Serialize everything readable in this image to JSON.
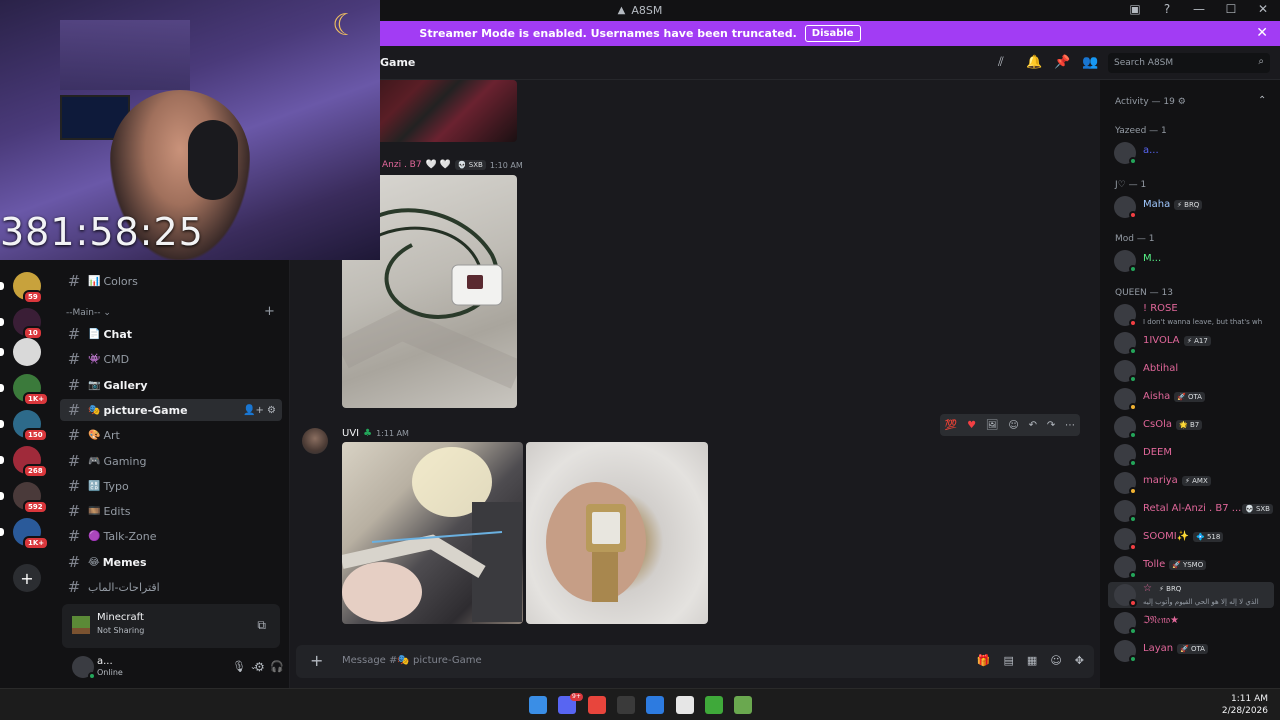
{
  "window": {
    "title": "A8SM",
    "controls": {
      "help": "?",
      "minimize": "—",
      "maximize": "☐",
      "close": "✕"
    }
  },
  "banner": {
    "text": "Streamer Mode is enabled. Usernames have been truncated.",
    "disable_label": "Disable"
  },
  "overlay": {
    "timer": "381:58:25"
  },
  "rail": {
    "servers": [
      {
        "badge": "59",
        "color": "#c8a23c"
      },
      {
        "badge": "10",
        "color": "#3a1e36"
      },
      {
        "badge": "",
        "color": "#d9d9d9"
      },
      {
        "badge": "1K+",
        "color": "#3b7a3b"
      },
      {
        "badge": "150",
        "color": "#2d6a8a"
      },
      {
        "badge": "268",
        "color": "#a02a3a"
      },
      {
        "badge": "592",
        "color": "#4a3a3a"
      },
      {
        "badge": "1K+",
        "color": "#2a5a9a"
      }
    ]
  },
  "sidebar": {
    "channels_top": [
      {
        "emoji": "📊",
        "label": "Colors",
        "bold": false
      }
    ],
    "category": "--Main--",
    "channels": [
      {
        "emoji": "📄",
        "label": "Chat",
        "bold": true
      },
      {
        "emoji": "👾",
        "label": "CMD",
        "bold": false
      },
      {
        "emoji": "📷",
        "label": "Gallery",
        "bold": true
      },
      {
        "emoji": "🎭",
        "label": "picture-Game",
        "bold": true,
        "active": true
      },
      {
        "emoji": "🎨",
        "label": "Art",
        "bold": false
      },
      {
        "emoji": "🎮",
        "label": "Gaming",
        "bold": false
      },
      {
        "emoji": "🔠",
        "label": "Typo",
        "bold": false
      },
      {
        "emoji": "🎞️",
        "label": "Edits",
        "bold": false
      },
      {
        "emoji": "🟣",
        "label": "Talk-Zone",
        "bold": false
      },
      {
        "emoji": "😂",
        "label": "Memes",
        "bold": true
      },
      {
        "emoji": "",
        "label": "اقتراحات-الماب",
        "bold": false
      }
    ]
  },
  "activity": {
    "game": "Minecraft",
    "status": "Not Sharing"
  },
  "user": {
    "name": "a...",
    "status": "Online"
  },
  "header": {
    "channel": "Game",
    "search_placeholder": "Search A8SM"
  },
  "messages": [
    {
      "author": "Anzi . B7",
      "hearts": "🤍 🤍",
      "tag": "💀 SXB",
      "time": "1:10 AM"
    },
    {
      "author": "UVI",
      "badge": "♣",
      "time": "1:11 AM"
    }
  ],
  "message_actions": [
    "💯",
    "♥",
    "🖼",
    "☺",
    "↶",
    "↷",
    "⋯"
  ],
  "composer": {
    "placeholder": "Message #🎭 picture-Game"
  },
  "members": {
    "activity_header": "Activity — 19 ⚙",
    "groups": [
      {
        "label": "Yazeed — 1",
        "members": [
          {
            "name": "a...",
            "color": "#5865f2",
            "tag": "",
            "status": "#23a55a"
          }
        ]
      },
      {
        "label": "J♡ — 1",
        "members": [
          {
            "name": "Maha",
            "color": "#a0c8ff",
            "tag": "⚡ BRQ",
            "status": "#f23f43"
          }
        ]
      },
      {
        "label": "Mod — 1",
        "members": [
          {
            "name": "M...",
            "color": "#57f287",
            "tag": "",
            "status": "#23a55a"
          }
        ]
      },
      {
        "label": "QUEEN — 13",
        "members": [
          {
            "name": "! ROSE",
            "color": "#e0679a",
            "tag": "",
            "status": "#f23f43",
            "sub": "I don't wanna leave, but that's wh"
          },
          {
            "name": "1IVOLA",
            "color": "#e0679a",
            "tag": "⚡ A17",
            "status": "#23a55a"
          },
          {
            "name": "Abtihal",
            "color": "#e0679a",
            "tag": "",
            "status": "#23a55a"
          },
          {
            "name": "Aisha",
            "color": "#e0679a",
            "tag": "🚀 OTA",
            "status": "#f0b232"
          },
          {
            "name": "CsOla",
            "color": "#e0679a",
            "tag": "🌟 B7",
            "status": "#23a55a"
          },
          {
            "name": "DEEM",
            "color": "#e0679a",
            "tag": "",
            "status": "#23a55a"
          },
          {
            "name": "mariya",
            "color": "#e0679a",
            "tag": "⚡ AMX",
            "status": "#f0b232"
          },
          {
            "name": "Retal Al-Anzi . B7 ...",
            "color": "#e0679a",
            "tag": "💀 SXB",
            "status": "#23a55a"
          },
          {
            "name": "SOOMI✨",
            "color": "#e0679a",
            "tag": "💠 518",
            "status": "#f23f43"
          },
          {
            "name": "Tolle",
            "color": "#e0679a",
            "tag": "🚀 YSMO",
            "status": "#23a55a"
          },
          {
            "name": "☆",
            "color": "#e0679a",
            "tag": "⚡ BRQ",
            "status": "#f23f43",
            "sub": "الذي لا إله إلا هو الحي القيوم وأتوب إليه"
          },
          {
            "name": "ℑ𝔑𝔢𝔫𝔬★",
            "color": "#e0679a",
            "tag": "",
            "status": "#23a55a"
          },
          {
            "name": "Layan",
            "color": "#e0679a",
            "tag": "🚀 OTA",
            "status": "#23a55a"
          }
        ]
      }
    ]
  },
  "taskbar": {
    "time": "1:11 AM",
    "date": "2/28/2026",
    "discord_badge": "9+",
    "apps": [
      {
        "name": "start",
        "color": "#3a8ee6"
      },
      {
        "name": "discord",
        "color": "#5865f2"
      },
      {
        "name": "chrome",
        "color": "#e8453c"
      },
      {
        "name": "obs",
        "color": "#3a3a3a"
      },
      {
        "name": "copilot",
        "color": "#2d7be0"
      },
      {
        "name": "capture",
        "color": "#e6e6e6"
      },
      {
        "name": "minecraft",
        "color": "#3fa93a"
      },
      {
        "name": "minecraft-launcher",
        "color": "#6aa84f"
      }
    ]
  }
}
